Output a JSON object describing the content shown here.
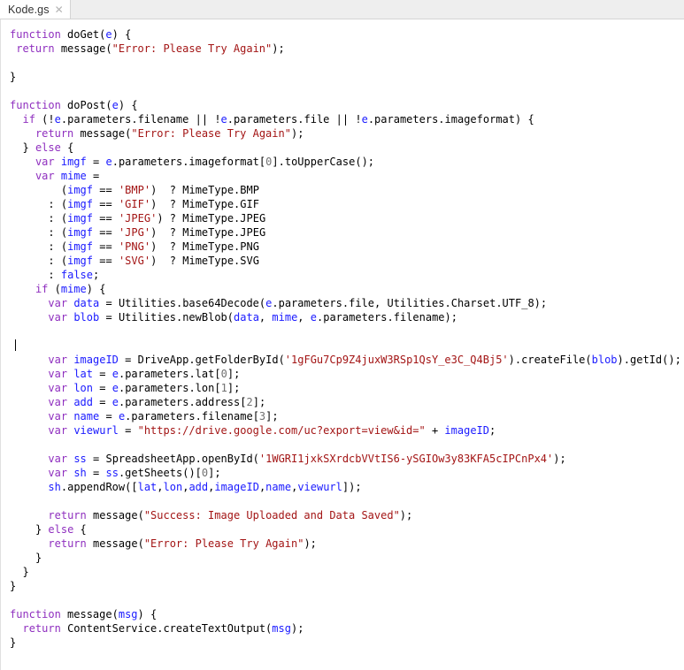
{
  "tab": {
    "label": "Kode.gs",
    "close_icon": "close-icon",
    "close_glyph": "✕"
  },
  "editor": {
    "language": "javascript",
    "colors": {
      "keyword": "#8f2fbf",
      "identifier": "#000000",
      "variable": "#1a1aff",
      "string": "#a31515",
      "number": "#707070",
      "background": "#ffffff",
      "tab_bar_background": "#eeeeee"
    },
    "caret_line": 23,
    "lines": [
      "function doGet(e) {",
      " return message(\"Error: Please Try Again\");",
      "",
      "}",
      "",
      "function doPost(e) {",
      "  if (!e.parameters.filename || !e.parameters.file || !e.parameters.imageformat) {",
      "    return message(\"Error: Please Try Again\");",
      "  } else {",
      "    var imgf = e.parameters.imageformat[0].toUpperCase();",
      "    var mime =",
      "        (imgf == 'BMP')  ? MimeType.BMP",
      "      : (imgf == 'GIF')  ? MimeType.GIF",
      "      : (imgf == 'JPEG') ? MimeType.JPEG",
      "      : (imgf == 'JPG')  ? MimeType.JPEG",
      "      : (imgf == 'PNG')  ? MimeType.PNG",
      "      : (imgf == 'SVG')  ? MimeType.SVG",
      "      : false;",
      "    if (mime) {",
      "      var data = Utilities.base64Decode(e.parameters.file, Utilities.Charset.UTF_8);",
      "      var blob = Utilities.newBlob(data, mime, e.parameters.filename);",
      "",
      "",
      "      var imageID = DriveApp.getFolderById('1gFGu7Cp9Z4juxW3RSp1QsY_e3C_Q4Bj5').createFile(blob).getId();",
      "      var lat = e.parameters.lat[0];",
      "      var lon = e.parameters.lon[1];",
      "      var add = e.parameters.address[2];",
      "      var name = e.parameters.filename[3];",
      "      var viewurl = \"https://drive.google.com/uc?export=view&id=\" + imageID;",
      "",
      "      var ss = SpreadsheetApp.openById('1WGRI1jxkSXrdcbVVtIS6-ySGIOw3y83KFA5cIPCnPx4');",
      "      var sh = ss.getSheets()[0];",
      "      sh.appendRow([lat,lon,add,imageID,name,viewurl]);",
      "",
      "      return message(\"Success: Image Uploaded and Data Saved\");",
      "    } else {",
      "      return message(\"Error: Please Try Again\");",
      "    }",
      "  }",
      "}",
      "",
      "function message(msg) {",
      "  return ContentService.createTextOutput(msg);",
      "}"
    ],
    "identifiers": {
      "functions": [
        "doGet",
        "doPost",
        "message"
      ],
      "parameters": [
        "e",
        "msg"
      ],
      "variables": [
        "imgf",
        "mime",
        "data",
        "blob",
        "imageID",
        "lat",
        "lon",
        "add",
        "name",
        "viewurl",
        "ss",
        "sh"
      ],
      "services": [
        "MimeType",
        "Utilities",
        "DriveApp",
        "SpreadsheetApp",
        "ContentService"
      ],
      "drive_folder_id": "1gFGu7Cp9Z4juxW3RSp1QsY_e3C_Q4Bj5",
      "spreadsheet_id": "1WGRI1jxkSXrdcbVVtIS6-ySGIOw3y83KFA5cIPCnPx4",
      "view_url_prefix": "https://drive.google.com/uc?export=view&id=",
      "messages": {
        "error": "Error: Please Try Again",
        "success": "Success: Image Uploaded and Data Saved"
      },
      "image_formats": [
        "BMP",
        "GIF",
        "JPEG",
        "JPG",
        "PNG",
        "SVG"
      ]
    }
  }
}
